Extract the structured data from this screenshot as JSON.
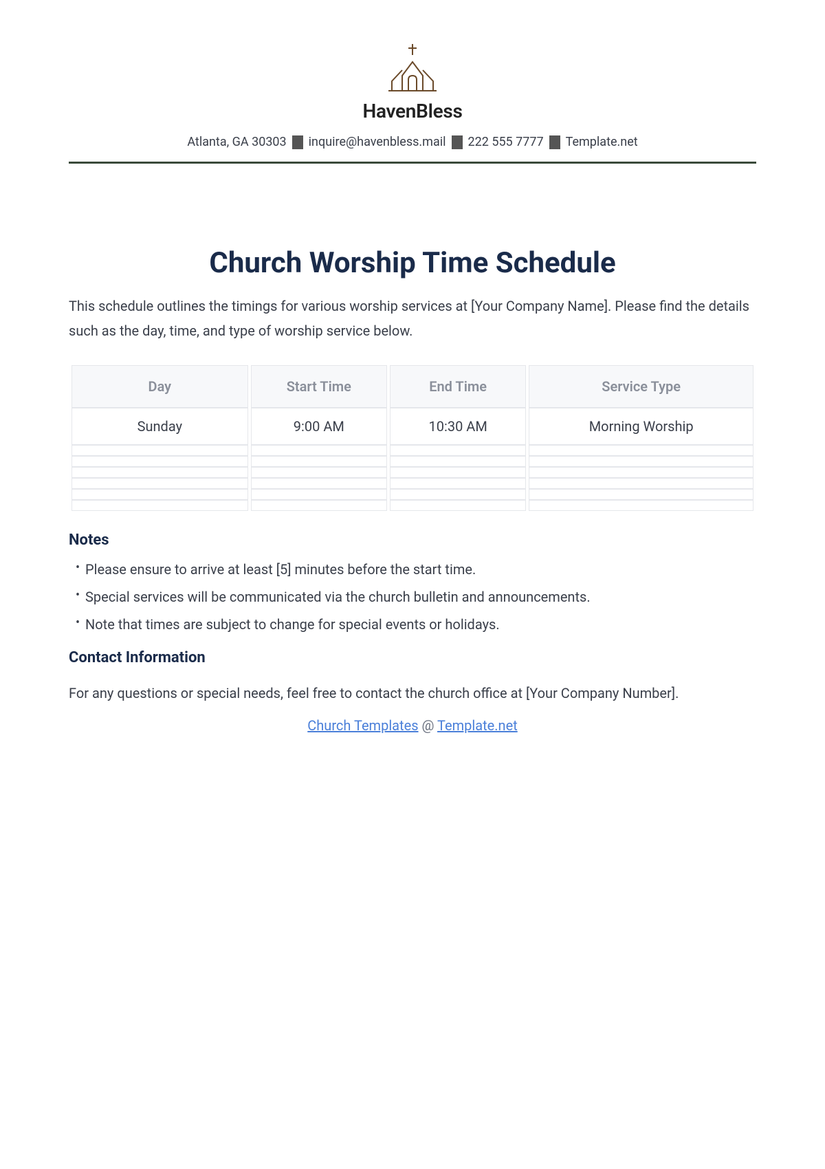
{
  "header": {
    "brand_name": "HavenBless",
    "location": "Atlanta, GA 30303",
    "email": "inquire@havenbless.mail",
    "phone": "222 555 7777",
    "site": "Template.net"
  },
  "document": {
    "title": "Church Worship Time Schedule",
    "intro": "This schedule outlines the timings for various worship services at [Your Company Name]. Please find the details such as the day, time, and type of worship service below."
  },
  "table": {
    "headers": {
      "day": "Day",
      "start": "Start Time",
      "end": "End Time",
      "service": "Service Type"
    },
    "rows": [
      {
        "day": "Sunday",
        "start": "9:00 AM",
        "end": "10:30 AM",
        "service": "Morning Worship"
      }
    ]
  },
  "notes": {
    "heading": "Notes",
    "items": [
      "Please ensure to arrive at least [5] minutes before the start time.",
      "Special services will be communicated via the church bulletin and announcements.",
      "Note that times are subject to change for special events or holidays."
    ]
  },
  "contact": {
    "heading": "Contact Information",
    "text": "For any questions or special needs, feel free to contact the church office at [Your Company Number]."
  },
  "footer": {
    "link1": "Church Templates",
    "sep": " @ ",
    "link2": "Template.net"
  }
}
